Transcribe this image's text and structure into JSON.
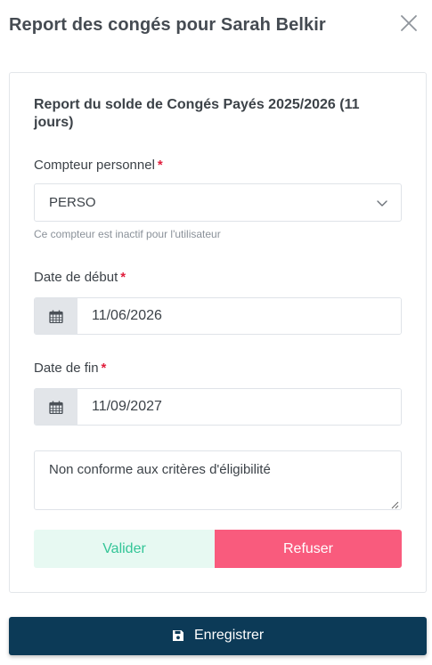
{
  "modal": {
    "title": "Report des congés pour Sarah Belkir"
  },
  "card": {
    "title": "Report du solde de Congés Payés 2025/2026 (11 jours)"
  },
  "counter": {
    "label": "Compteur personnel",
    "required_mark": "*",
    "selected": "PERSO",
    "help": "Ce compteur est inactif pour l'utilisateur"
  },
  "start_date": {
    "label": "Date de début",
    "required_mark": "*",
    "value": "11/06/2026"
  },
  "end_date": {
    "label": "Date de fin",
    "required_mark": "*",
    "value": "11/09/2027"
  },
  "comment": {
    "value": "Non conforme aux critères d'éligibilité"
  },
  "actions": {
    "validate_label": "Valider",
    "refuse_label": "Refuser",
    "save_label": "Enregistrer"
  },
  "icons": {
    "close": "close-icon",
    "chevron": "chevron-down-icon",
    "calendar": "calendar-icon",
    "save": "floppy-disk-icon"
  },
  "colors": {
    "primary_dark": "#0c3a57",
    "validate_bg": "#e7f9f2",
    "validate_text": "#33c597",
    "refuse_bg": "#f95b7d",
    "required": "#e01e3c"
  }
}
